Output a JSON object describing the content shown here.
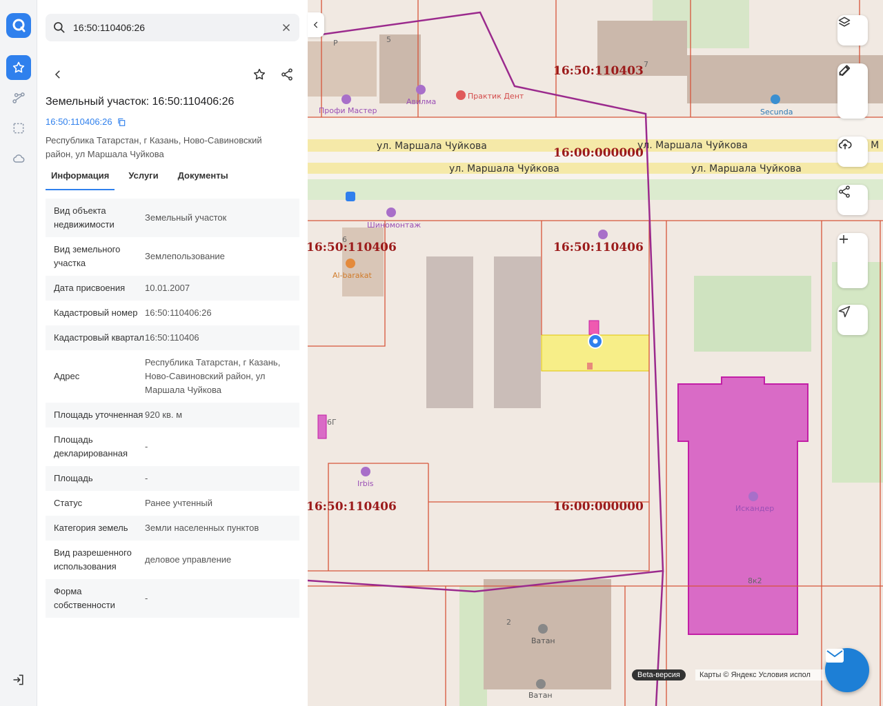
{
  "search": {
    "value": "16:50:110406:26"
  },
  "parcel": {
    "title": "Земельный участок: 16:50:110406:26",
    "cad_link": "16:50:110406:26",
    "address": "Республика Татарстан, г Казань, Ново-Савиновский район, ул Маршала Чуйкова"
  },
  "tabs": [
    "Информация",
    "Услуги",
    "Документы"
  ],
  "info_rows": [
    {
      "k": "Вид объекта недвижимости",
      "v": "Земельный участок"
    },
    {
      "k": "Вид земельного участка",
      "v": "Землепользование"
    },
    {
      "k": "Дата присвоения",
      "v": "10.01.2007"
    },
    {
      "k": "Кадастровый номер",
      "v": "16:50:110406:26"
    },
    {
      "k": "Кадастровый квартал",
      "v": "16:50:110406"
    },
    {
      "k": "Адрес",
      "v": "Республика Татарстан, г Казань, Ново-Савиновский район, ул Маршала Чуйкова"
    },
    {
      "k": "Площадь уточненная",
      "v": "920 кв. м"
    },
    {
      "k": "Площадь декларированная",
      "v": "-"
    },
    {
      "k": "Площадь",
      "v": "-"
    },
    {
      "k": "Статус",
      "v": "Ранее учтенный"
    },
    {
      "k": "Категория земель",
      "v": "Земли населенных пунктов"
    },
    {
      "k": "Вид разрешенного использования",
      "v": "деловое управление"
    },
    {
      "k": "Форма собственности",
      "v": "-"
    }
  ],
  "map": {
    "quarters": [
      "16:50:110403",
      "16:00:000000",
      "16:50:110406",
      "16:50:110406",
      "16:50:110406",
      "16:00:000000"
    ],
    "streets": [
      "ул. Маршала Чуйкова",
      "ул. Маршала Чуйкова",
      "ул. Маршала Чуйкова",
      "ул. Маршала Чуйкова",
      "ул. М"
    ],
    "pois": [
      "Профи Мастер",
      "Авилма",
      "Практик Дент",
      "Secunda",
      "Шиномонтаж",
      "Al-barakat",
      "Irbis",
      "Искандер",
      "Ватан",
      "Ватан"
    ],
    "house_numbers": [
      "P",
      "5",
      "7",
      "6",
      "6Г",
      "2",
      "8к2"
    ],
    "beta": "Beta-версия",
    "attribution": "Карты © Яндекс   Условия испол"
  }
}
